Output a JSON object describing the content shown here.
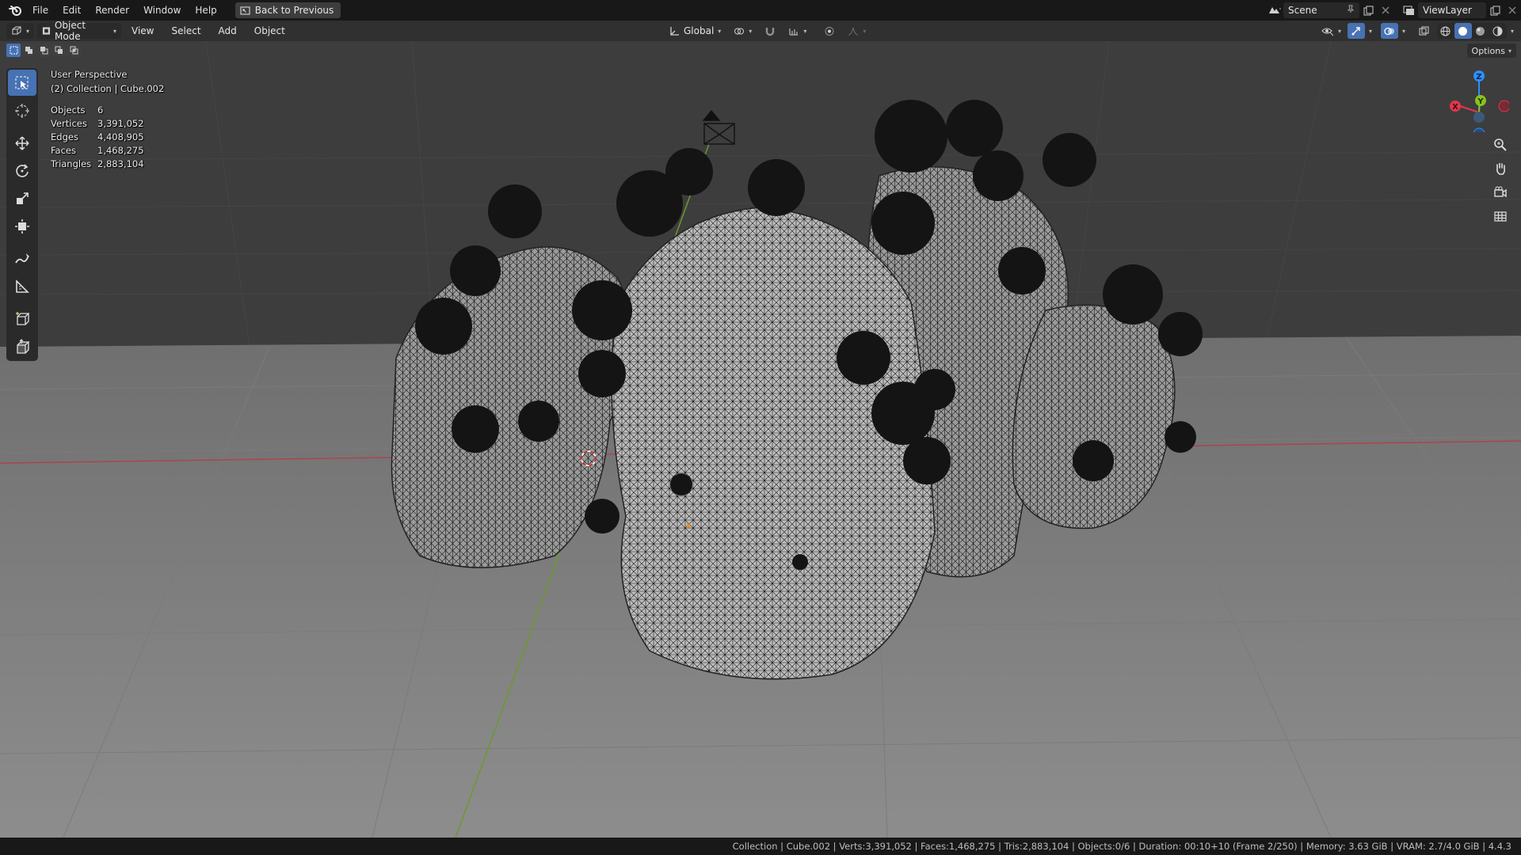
{
  "menubar": {
    "items": [
      "File",
      "Edit",
      "Render",
      "Window",
      "Help"
    ],
    "back_button": "Back to Previous"
  },
  "workspace": {
    "scene": "Scene",
    "view_layer": "ViewLayer"
  },
  "header": {
    "mode": "Object Mode",
    "menus": [
      "View",
      "Select",
      "Add",
      "Object"
    ],
    "transform_orientation": "Global",
    "options_label": "Options"
  },
  "viewport": {
    "view_name": "User Perspective",
    "collection_path": "(2) Collection | Cube.002",
    "stats": [
      {
        "label": "Objects",
        "value": "6"
      },
      {
        "label": "Vertices",
        "value": "3,391,052"
      },
      {
        "label": "Edges",
        "value": "4,408,905"
      },
      {
        "label": "Faces",
        "value": "1,468,275"
      },
      {
        "label": "Triangles",
        "value": "2,883,104"
      }
    ]
  },
  "gizmo": {
    "axes": [
      "X",
      "Y",
      "Z"
    ],
    "colors": {
      "x": "#e3374b",
      "y": "#89c219",
      "z": "#2c8fff"
    }
  },
  "toolbar": {
    "tools": [
      "select-box",
      "cursor",
      "move",
      "rotate",
      "scale",
      "transform",
      "annotate",
      "measure",
      "add-cube",
      "extrude"
    ]
  },
  "statusbar": {
    "text": "Collection | Cube.002 | Verts:3,391,052 | Faces:1,468,275 | Tris:2,883,104 | Objects:0/6 | Duration: 00:10+10 (Frame 2/250) | Memory: 3.63 GiB | VRAM: 2.7/4.0 GiB | 4.4.3"
  }
}
